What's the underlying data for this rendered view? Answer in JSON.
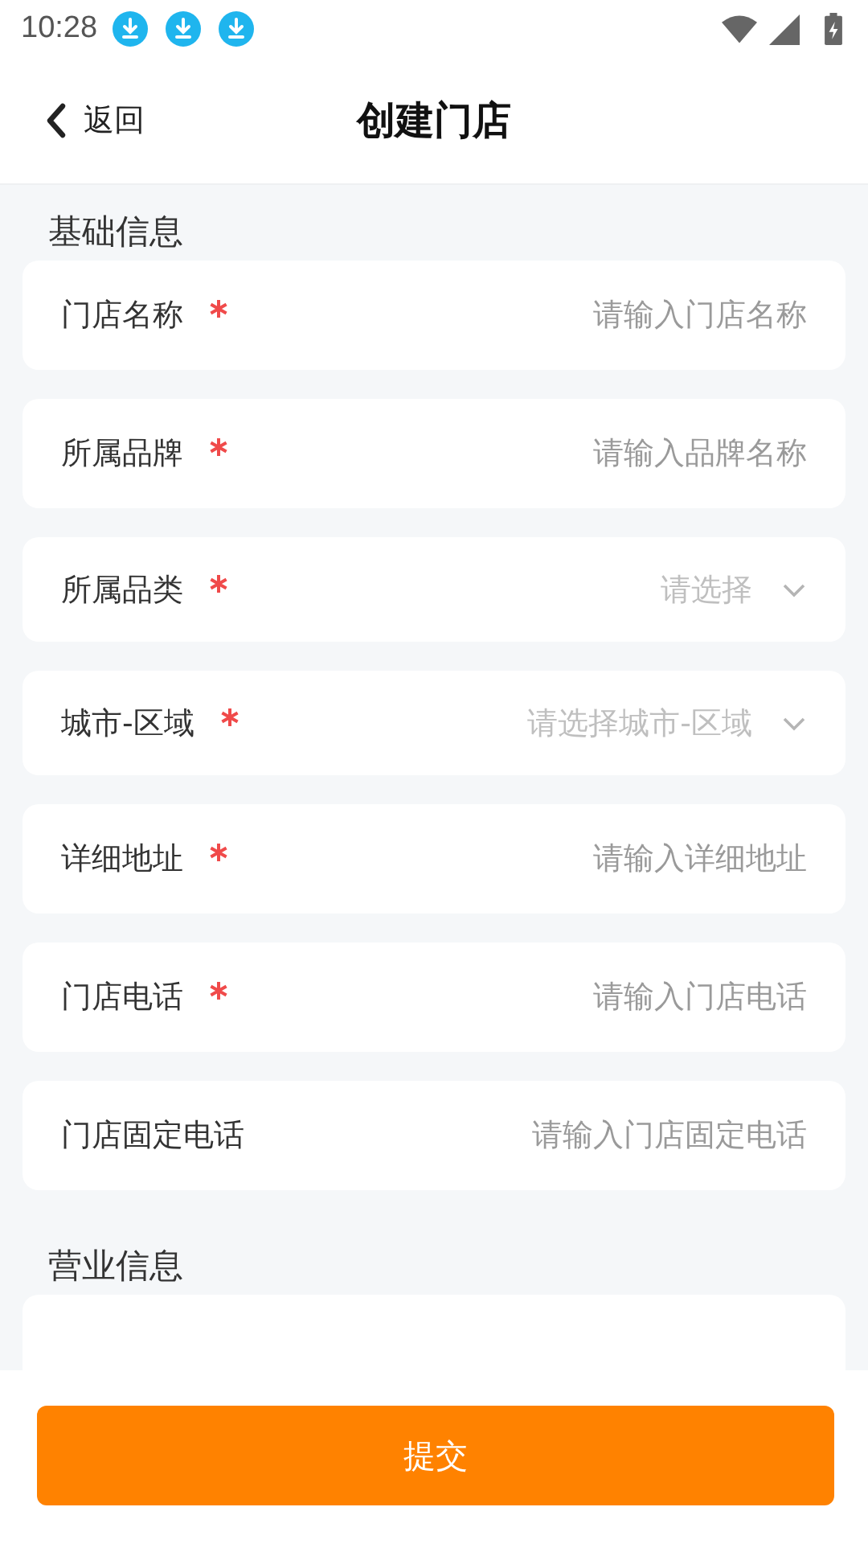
{
  "status_bar": {
    "time": "10:28",
    "notifications": [
      {
        "kind": "download"
      },
      {
        "kind": "download"
      },
      {
        "kind": "download"
      }
    ]
  },
  "header": {
    "back": "返回",
    "title": "创建门店"
  },
  "sections": [
    {
      "title": "基础信息",
      "fields": [
        {
          "kind": "input",
          "label": "门店名称",
          "required": true,
          "placeholder": "请输入门店名称"
        },
        {
          "kind": "input",
          "label": "所属品牌",
          "required": true,
          "placeholder": "请输入品牌名称"
        },
        {
          "kind": "select",
          "label": "所属品类",
          "required": true,
          "placeholder": "请选择"
        },
        {
          "kind": "select",
          "label": "城市-区域",
          "required": true,
          "placeholder": "请选择城市-区域"
        },
        {
          "kind": "input",
          "label": "详细地址",
          "required": true,
          "placeholder": "请输入详细地址"
        },
        {
          "kind": "input",
          "label": "门店电话",
          "required": true,
          "placeholder": "请输入门店电话"
        },
        {
          "kind": "input",
          "label": "门店固定电话",
          "required": false,
          "placeholder": "请输入门店固定电话"
        }
      ]
    },
    {
      "title": "营业信息",
      "fields": [
        {
          "kind": "cut"
        }
      ]
    }
  ],
  "submit": "提交"
}
